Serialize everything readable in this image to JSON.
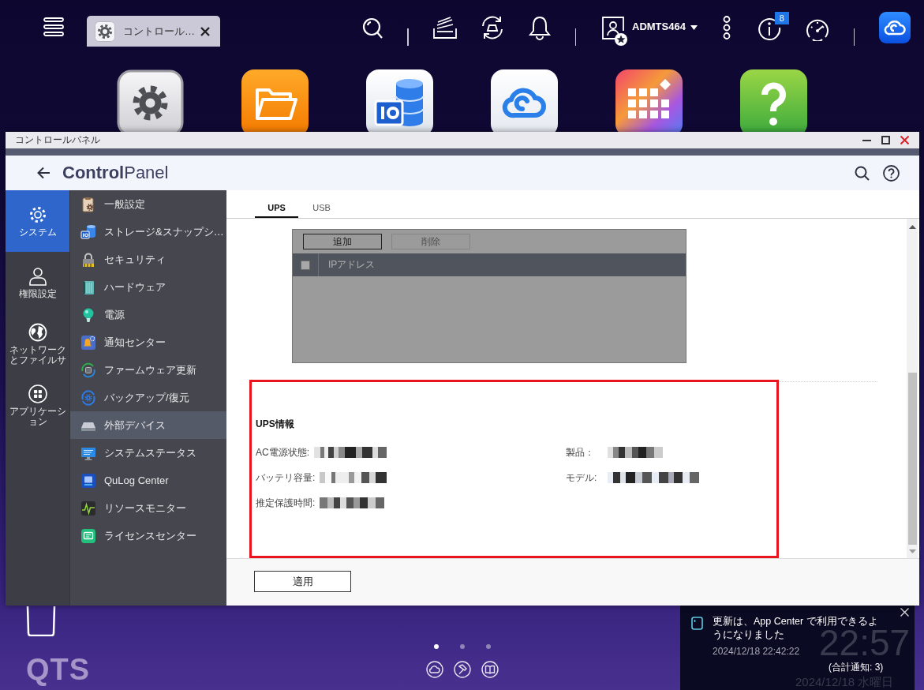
{
  "topbar": {
    "tabs": [
      {
        "label": "コントロール…",
        "selected": true
      }
    ],
    "user": "ADMTS464",
    "info_badge": "8"
  },
  "window": {
    "title": "コントロールパネル",
    "app_title": "**Control**Panel"
  },
  "rail": [
    {
      "kind": "system",
      "label": "システム",
      "selected": true
    },
    {
      "kind": "privilege",
      "label": "権限設定",
      "selected": false
    },
    {
      "kind": "network",
      "label": "ネットワークとファイルサ",
      "selected": false
    },
    {
      "kind": "apps",
      "label": "アプリケーション",
      "selected": false
    }
  ],
  "menu": [
    {
      "kind": "general",
      "label": "一般設定",
      "selected": false
    },
    {
      "kind": "storage",
      "label": "ストレージ&スナップシ…",
      "selected": false
    },
    {
      "kind": "security",
      "label": "セキュリティ",
      "selected": false
    },
    {
      "kind": "hardware",
      "label": "ハードウェア",
      "selected": false
    },
    {
      "kind": "power",
      "label": "電源",
      "selected": false
    },
    {
      "kind": "notification",
      "label": "通知センター",
      "selected": false
    },
    {
      "kind": "firmware",
      "label": "ファームウェア更新",
      "selected": false
    },
    {
      "kind": "backup",
      "label": "バックアップ/復元",
      "selected": false
    },
    {
      "kind": "external",
      "label": "外部デバイス",
      "selected": true
    },
    {
      "kind": "status",
      "label": "システムステータス",
      "selected": false
    },
    {
      "kind": "qulog",
      "label": "QuLog Center",
      "selected": false
    },
    {
      "kind": "monitor",
      "label": "リソースモニター",
      "selected": false
    },
    {
      "kind": "license",
      "label": "ライセンスセンター",
      "selected": false
    }
  ],
  "tabs": [
    {
      "label": "UPS",
      "selected": true
    },
    {
      "label": "USB",
      "selected": false
    }
  ],
  "ip_list": {
    "buttons": [
      {
        "label": "追加",
        "disabled": false
      },
      {
        "label": "削除",
        "disabled": true
      }
    ],
    "select_all": {
      "checked": false
    },
    "columns": [
      "IPアドレス"
    ]
  },
  "ups_info": {
    "title": "UPS情報",
    "highlighted": true,
    "left": [
      {
        "label": "AC電源状態:",
        "redacted": true
      },
      {
        "label": "バッテリ容量:",
        "redacted": true
      },
      {
        "label": "推定保護時間:",
        "redacted": true
      }
    ],
    "right": [
      {
        "label": "製品：",
        "redacted": true
      },
      {
        "label": "モデル:",
        "redacted": true
      }
    ]
  },
  "footer": {
    "apply": "適用"
  },
  "desktop": {
    "brand": "QTS",
    "pages": [
      {
        "selected": true
      },
      {
        "selected": false
      },
      {
        "selected": false
      }
    ],
    "clock": "22:57",
    "date": "2024/12/18 水曜日"
  },
  "notification": {
    "message": "更新は、App Center で利用できるようになりました",
    "time": "2024/12/18 22:42:22",
    "total": "(合計通知: 3)"
  }
}
